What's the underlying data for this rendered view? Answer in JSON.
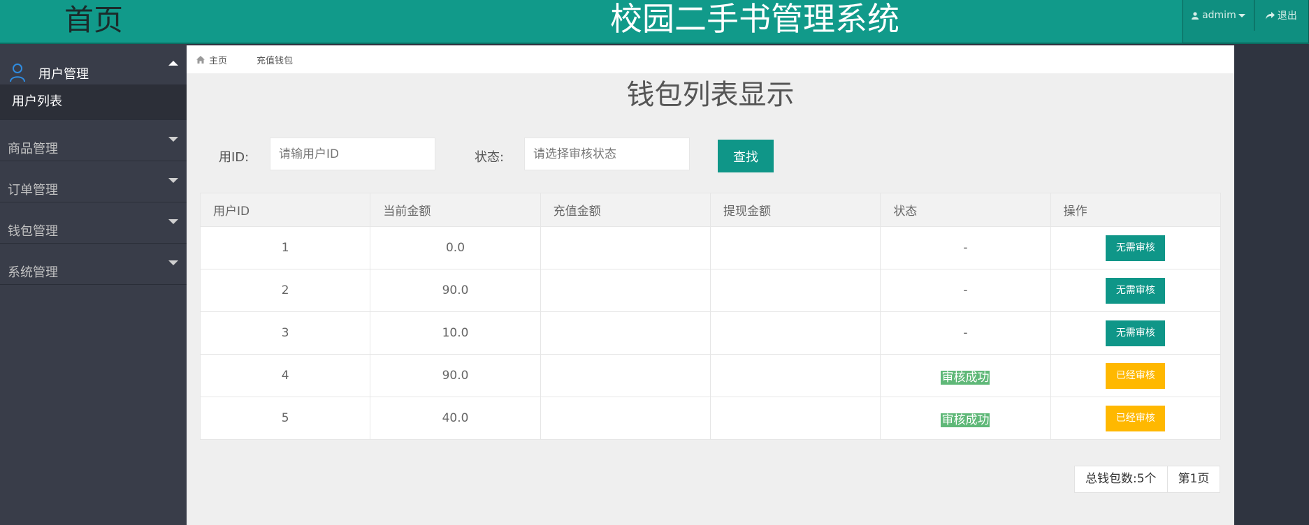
{
  "header": {
    "brand": "首页",
    "title": "校园二手书管理系统",
    "user_label": "admim",
    "logout_label": "退出"
  },
  "sidebar": {
    "groups": [
      {
        "label": "用户管理",
        "open": true,
        "items": [
          {
            "label": "用户列表"
          }
        ]
      },
      {
        "label": "商品管理"
      },
      {
        "label": "订单管理"
      },
      {
        "label": "钱包管理"
      },
      {
        "label": "系统管理"
      }
    ]
  },
  "breadcrumb": {
    "home": "主页",
    "current": "充值钱包"
  },
  "page_title": "钱包列表显示",
  "search": {
    "user_id_label": "用ID:",
    "user_id_placeholder": "请输用户ID",
    "status_label": "状态:",
    "status_placeholder": "请选择审核状态",
    "find_button": "查找"
  },
  "table": {
    "columns": [
      "用户ID",
      "当前金额",
      "充值金额",
      "提现金额",
      "状态",
      "操作"
    ],
    "rows": [
      {
        "id": "1",
        "balance": "0.0",
        "recharge": "",
        "withdraw": "",
        "status": "-",
        "action": "无需审核"
      },
      {
        "id": "2",
        "balance": "90.0",
        "recharge": "",
        "withdraw": "",
        "status": "-",
        "action": "无需审核"
      },
      {
        "id": "3",
        "balance": "10.0",
        "recharge": "",
        "withdraw": "",
        "status": "-",
        "action": "无需审核"
      },
      {
        "id": "4",
        "balance": "90.0",
        "recharge": "",
        "withdraw": "",
        "status": "审核成功",
        "action": "已经审核"
      },
      {
        "id": "5",
        "balance": "40.0",
        "recharge": "",
        "withdraw": "",
        "status": "审核成功",
        "action": "已经审核"
      }
    ]
  },
  "pager": {
    "total": "总钱包数:5个",
    "page": "第1页"
  },
  "colors": {
    "header": "#119a8a",
    "sidebar": "#393d49",
    "accent_green": "#0f9688",
    "accent_yellow": "#ffb800",
    "status_success": "#5fb878"
  }
}
